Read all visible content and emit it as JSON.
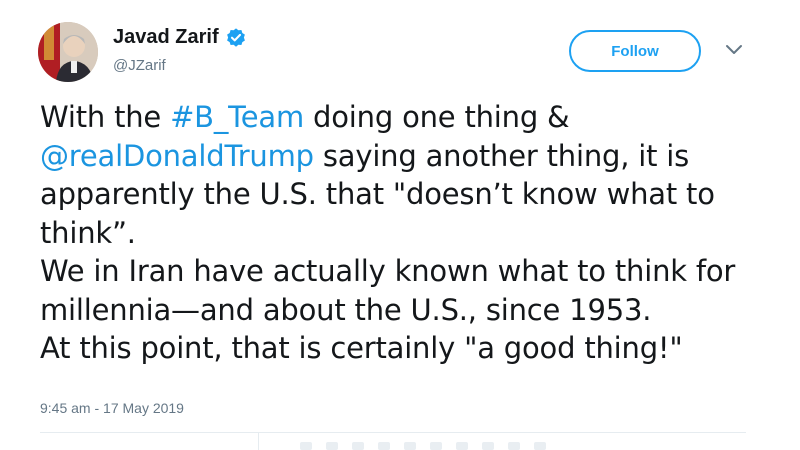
{
  "author": {
    "display_name": "Javad Zarif",
    "handle": "@JZarif",
    "verified": true,
    "verified_icon": "verified-badge-icon"
  },
  "actions": {
    "follow_label": "Follow",
    "more_icon": "chevron-down-icon"
  },
  "tweet": {
    "p1": {
      "t1": "With the ",
      "hashtag": "#B_Team",
      "t2": " doing one thing & ",
      "mention": "@realDonaldTrump",
      "t3": " saying another thing, it is apparently the U.S. that \"doesn’t know what to think”."
    },
    "p2": "We in Iran have actually known what to think for millennia—and about the U.S., since 1953.",
    "p3": "At this point, that is certainly \"a good thing!\""
  },
  "timestamp": "9:45 am - 17 May 2019",
  "colors": {
    "accent": "#1da1f2",
    "link": "#1b95e0",
    "text": "#14171a",
    "muted": "#657786"
  }
}
